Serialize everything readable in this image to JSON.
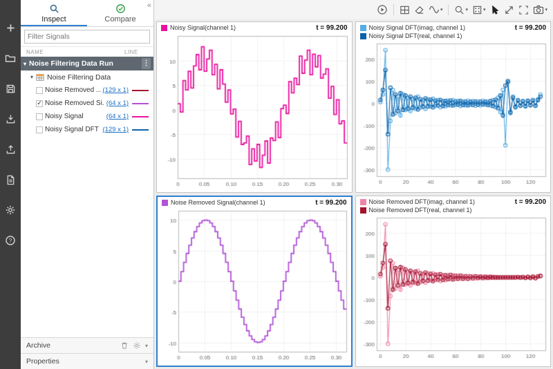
{
  "sidebar": {
    "icons": [
      "add",
      "open",
      "save",
      "import",
      "export",
      "report",
      "preferences",
      "help"
    ]
  },
  "panel": {
    "tabs": [
      {
        "label": "Inspect",
        "active": true
      },
      {
        "label": "Compare",
        "active": false
      }
    ],
    "filter_placeholder": "Filter Signals",
    "columns": {
      "name": "NAME",
      "line": "LINE"
    },
    "run": {
      "label": "Noise Filtering Data Run"
    },
    "group": {
      "label": "Noise Filtering Data"
    },
    "signals": [
      {
        "name": "Noise Removed ...",
        "dims": "(129 x 1)",
        "color": "#a2142f",
        "check": ""
      },
      {
        "name": "Noise Removed Si...",
        "dims": "(64 x 1)",
        "color": "#b153d6",
        "check": "✓"
      },
      {
        "name": "Noisy Signal",
        "dims": "(64 x 1)",
        "color": "#e8119d",
        "check": ""
      },
      {
        "name": "Noisy Signal DFT",
        "dims": "(129 x 1)",
        "color": "#0d62a8",
        "check": ""
      }
    ],
    "archive": {
      "label": "Archive"
    },
    "properties": {
      "label": "Properties"
    }
  },
  "toolbar": {
    "icons": [
      "play-circle",
      "layout",
      "eraser",
      "signal-style",
      "zoom",
      "fit-to-view",
      "pointer",
      "expand",
      "fullscreen",
      "snapshot"
    ]
  },
  "chart_data": [
    {
      "type": "stair",
      "selected": false,
      "time": "t = 99.200",
      "title": "Noisy Signal(channel 1)",
      "x_start": 0,
      "x_step": 0.005,
      "xlim": [
        0,
        0.32
      ],
      "ylim": [
        -14,
        15
      ],
      "xticks": [
        0,
        0.05,
        0.1,
        0.15,
        0.2,
        0.25,
        0.3
      ],
      "xtick_labels": [
        "0",
        "0.05",
        "0.10",
        "0.15",
        "0.20",
        "0.25",
        "0.30"
      ],
      "yticks": [
        -10,
        -5,
        0,
        5,
        10
      ],
      "grid": true,
      "legend_position": "top-left",
      "series": [
        {
          "name": "Noisy Signal(channel 1)",
          "color": "#e8119d",
          "values": [
            1.2,
            -0.5,
            5.9,
            4.0,
            7.8,
            4.4,
            8.9,
            11.2,
            8.1,
            12.8,
            7.8,
            10.3,
            12.1,
            7.1,
            9.2,
            4.2,
            8.1,
            5.2,
            1.5,
            4.0,
            -0.9,
            0.1,
            -5.6,
            -2.4,
            -7.1,
            -6.8,
            -5.4,
            -11.2,
            -8.0,
            -10.5,
            -7.1,
            -11.8,
            -9.3,
            -6.4,
            -10.9,
            -5.8,
            -6.3,
            -2.5,
            -5.7,
            0.2,
            0.9,
            -0.8,
            5.7,
            3.4,
            6.4,
            5.1,
            10.9,
            7.4,
            10.1,
            12.1,
            7.1,
            11.3,
            8.7,
            11.0,
            6.4,
            7.2,
            8.3,
            2.3,
            4.7,
            -1.0,
            2.0,
            -2.9,
            -2.3,
            -6.8
          ]
        }
      ]
    },
    {
      "type": "line-marker",
      "selected": false,
      "time": "t = 99.200",
      "title": "Noisy Signal DFT",
      "x_start": 0,
      "x_step": 2,
      "xlim": [
        -3,
        132
      ],
      "ylim": [
        -330,
        270
      ],
      "xticks": [
        0,
        20,
        40,
        60,
        80,
        100,
        120
      ],
      "xtick_labels": [
        "0",
        "20",
        "40",
        "60",
        "80",
        "100",
        "120"
      ],
      "yticks": [
        -300,
        -200,
        -100,
        0,
        100,
        200
      ],
      "grid": true,
      "legend_position": "top-left",
      "series": [
        {
          "name": "Noisy Signal DFT(imag, channel 1)",
          "color": "#56ade4",
          "values": [
            5,
            40,
            240,
            -300,
            -80,
            60,
            -45,
            30,
            -55,
            40,
            -30,
            25,
            -35,
            20,
            -25,
            30,
            -20,
            15,
            -25,
            18,
            -15,
            20,
            -12,
            15,
            -18,
            10,
            -14,
            12,
            -10,
            14,
            -8,
            10,
            -12,
            8,
            -10,
            12,
            -7,
            9,
            -11,
            7,
            -9,
            11,
            -6,
            8,
            -10,
            14,
            -18,
            25,
            -40,
            60,
            -190,
            95,
            -45,
            30,
            -20,
            15,
            -12,
            10,
            -14,
            12,
            -10,
            15,
            -12,
            18,
            40
          ]
        },
        {
          "name": "Noisy Signal DFT(real, channel 1)",
          "color": "#0d62a8",
          "values": [
            15,
            60,
            150,
            -140,
            70,
            -50,
            40,
            -35,
            45,
            -30,
            35,
            -25,
            30,
            -20,
            25,
            -28,
            18,
            -15,
            22,
            -14,
            16,
            -18,
            12,
            -10,
            15,
            -12,
            10,
            -8,
            12,
            -10,
            8,
            -6,
            10,
            -8,
            7,
            -9,
            6,
            -7,
            8,
            -6,
            7,
            -5,
            6,
            -8,
            9,
            -12,
            16,
            -22,
            35,
            -55,
            80,
            100,
            -40,
            25,
            -15,
            12,
            -10,
            8,
            -12,
            10,
            -8,
            12,
            -10,
            14,
            30
          ]
        }
      ]
    },
    {
      "type": "stair",
      "selected": true,
      "time": "t = 99.200",
      "title": "Noise Removed Signal(channel 1)",
      "x_start": 0,
      "x_step": 0.005,
      "xlim": [
        0,
        0.32
      ],
      "ylim": [
        -11.5,
        11.5
      ],
      "xticks": [
        0,
        0.05,
        0.1,
        0.15,
        0.2,
        0.25,
        0.3
      ],
      "xtick_labels": [
        "0",
        "0.05",
        "0.10",
        "0.15",
        "0.20",
        "0.25",
        "0.30"
      ],
      "yticks": [
        -10,
        -5,
        0,
        5,
        10
      ],
      "grid": true,
      "legend_position": "top-left",
      "series": [
        {
          "name": "Noise Removed Signal(channel 1)",
          "color": "#b153d6",
          "values": [
            0,
            1.56,
            3.09,
            4.54,
            5.88,
            7.07,
            8.09,
            8.91,
            9.51,
            9.88,
            10,
            9.88,
            9.51,
            8.91,
            8.09,
            7.07,
            5.88,
            4.54,
            3.09,
            1.56,
            0,
            -1.56,
            -3.09,
            -4.54,
            -5.88,
            -7.07,
            -8.09,
            -8.91,
            -9.51,
            -9.88,
            -10,
            -9.88,
            -9.51,
            -8.91,
            -8.09,
            -7.07,
            -5.88,
            -4.54,
            -3.09,
            -1.56,
            0,
            1.56,
            3.09,
            4.54,
            5.88,
            7.07,
            8.09,
            8.91,
            9.51,
            9.88,
            10,
            9.88,
            9.51,
            8.91,
            8.09,
            7.07,
            5.88,
            4.54,
            3.09,
            1.56,
            0,
            -1.56,
            -3.09,
            -4.54
          ]
        }
      ]
    },
    {
      "type": "line-marker",
      "selected": false,
      "time": "t = 99.200",
      "title": "Noise Removed DFT",
      "x_start": 0,
      "x_step": 2,
      "xlim": [
        -3,
        132
      ],
      "ylim": [
        -330,
        270
      ],
      "xticks": [
        0,
        20,
        40,
        60,
        80,
        100,
        120
      ],
      "xtick_labels": [
        "0",
        "20",
        "40",
        "60",
        "80",
        "100",
        "120"
      ],
      "yticks": [
        -300,
        -200,
        -100,
        0,
        100,
        200
      ],
      "grid": true,
      "legend_position": "top-left",
      "series": [
        {
          "name": "Noise Removed DFT(imag, channel 1)",
          "color": "#ee85a8",
          "values": [
            5,
            45,
            240,
            -300,
            -85,
            65,
            -50,
            35,
            -55,
            42,
            -32,
            26,
            -36,
            22,
            -26,
            30,
            -22,
            16,
            -24,
            18,
            -14,
            18,
            -12,
            14,
            -16,
            10,
            -12,
            10,
            -8,
            10,
            -7,
            8,
            -6,
            6,
            -5,
            6,
            -4,
            5,
            -4,
            4,
            -3,
            4,
            -3,
            3,
            -2,
            2,
            -2,
            1,
            0,
            0,
            0,
            0,
            0,
            0,
            0,
            1,
            -1,
            2,
            -2,
            2,
            -3,
            3,
            -4,
            5,
            8
          ]
        },
        {
          "name": "Noise Removed DFT(real, channel 1)",
          "color": "#a2142f",
          "values": [
            15,
            65,
            150,
            -140,
            75,
            -55,
            42,
            -36,
            46,
            -32,
            36,
            -26,
            30,
            -22,
            26,
            -28,
            18,
            -16,
            22,
            -14,
            16,
            -17,
            12,
            -10,
            14,
            -11,
            9,
            -8,
            11,
            -9,
            7,
            -6,
            8,
            -6,
            5,
            -6,
            4,
            -4,
            5,
            -3,
            3,
            -3,
            2,
            -2,
            2,
            -1,
            1,
            -1,
            0,
            0,
            0,
            0,
            0,
            0,
            0,
            1,
            -1,
            1,
            -2,
            2,
            -2,
            3,
            -3,
            4,
            6
          ]
        }
      ]
    }
  ]
}
